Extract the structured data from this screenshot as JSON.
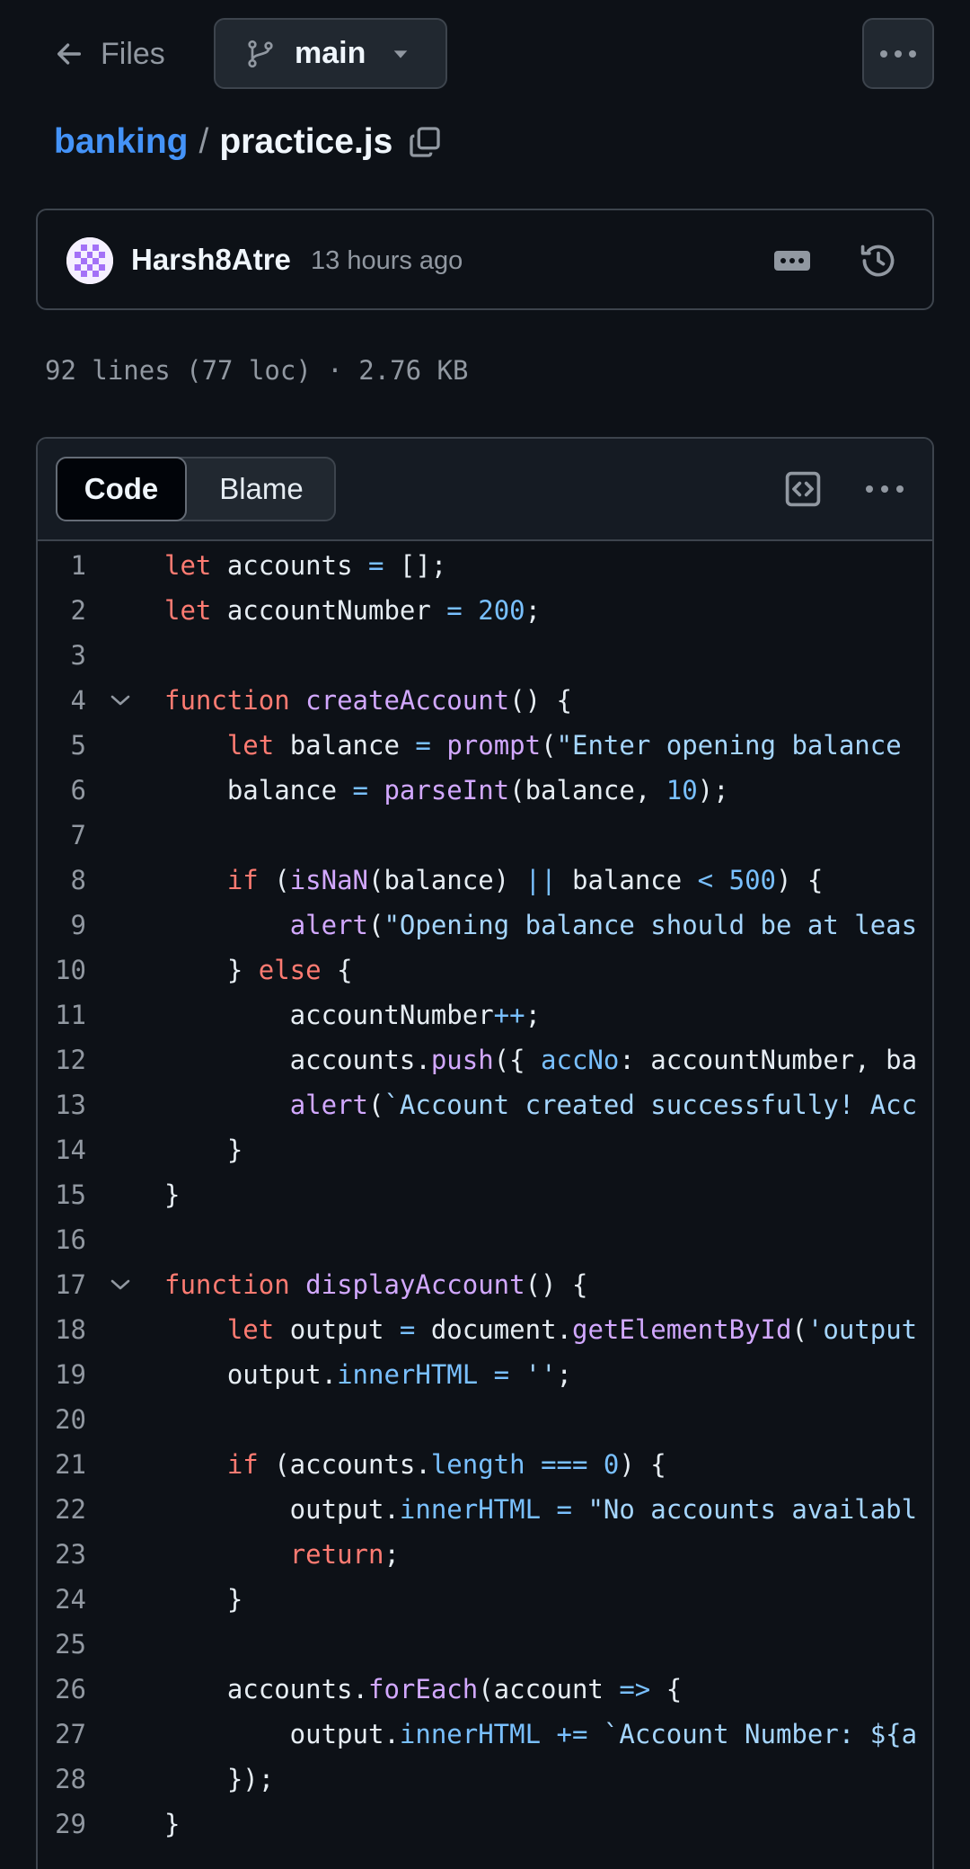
{
  "header": {
    "back_label": "Files",
    "branch_name": "main",
    "repo": "banking",
    "separator": "/",
    "file_name": "practice.js"
  },
  "commit": {
    "author": "Harsh8Atre",
    "time": "13 hours ago"
  },
  "file_meta": "92 lines (77 loc) · 2.76 KB",
  "tabs": {
    "code": "Code",
    "blame": "Blame"
  },
  "code_lines": [
    {
      "n": "1",
      "t": "let accounts = [];"
    },
    {
      "n": "2",
      "t": "let accountNumber = 200;"
    },
    {
      "n": "3",
      "t": ""
    },
    {
      "n": "4",
      "t": "function createAccount() {",
      "fold": true
    },
    {
      "n": "5",
      "t": "    let balance = prompt(\"Enter opening balance"
    },
    {
      "n": "6",
      "t": "    balance = parseInt(balance, 10);"
    },
    {
      "n": "7",
      "t": ""
    },
    {
      "n": "8",
      "t": "    if (isNaN(balance) || balance < 500) {"
    },
    {
      "n": "9",
      "t": "        alert(\"Opening balance should be at leas"
    },
    {
      "n": "10",
      "t": "    } else {"
    },
    {
      "n": "11",
      "t": "        accountNumber++;"
    },
    {
      "n": "12",
      "t": "        accounts.push({ accNo: accountNumber, ba"
    },
    {
      "n": "13",
      "t": "        alert(`Account created successfully! Acc"
    },
    {
      "n": "14",
      "t": "    }"
    },
    {
      "n": "15",
      "t": "}"
    },
    {
      "n": "16",
      "t": ""
    },
    {
      "n": "17",
      "t": "function displayAccount() {",
      "fold": true
    },
    {
      "n": "18",
      "t": "    let output = document.getElementById('output"
    },
    {
      "n": "19",
      "t": "    output.innerHTML = '';"
    },
    {
      "n": "20",
      "t": ""
    },
    {
      "n": "21",
      "t": "    if (accounts.length === 0) {"
    },
    {
      "n": "22",
      "t": "        output.innerHTML = \"No accounts availabl"
    },
    {
      "n": "23",
      "t": "        return;"
    },
    {
      "n": "24",
      "t": "    }"
    },
    {
      "n": "25",
      "t": ""
    },
    {
      "n": "26",
      "t": "    accounts.forEach(account => {"
    },
    {
      "n": "27",
      "t": "        output.innerHTML += `Account Number: ${a"
    },
    {
      "n": "28",
      "t": "    });"
    },
    {
      "n": "29",
      "t": "}"
    }
  ],
  "syntax_colors": {
    "keyword": "#ff7b72",
    "function": "#d2a8ff",
    "number": "#79c0ff",
    "string": "#a5d6ff",
    "plain": "#e6edf3",
    "line_number": "#9198a1",
    "background": "#0d1117",
    "link": "#4493f8"
  }
}
